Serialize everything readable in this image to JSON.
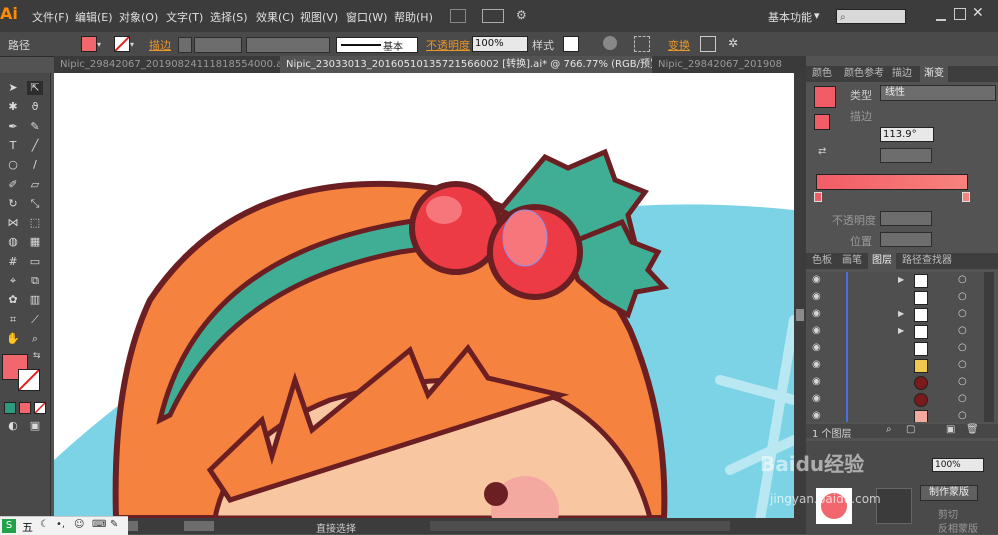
{
  "app": {
    "logo_text": "Ai"
  },
  "menubar": {
    "items": [
      "文件(F)",
      "编辑(E)",
      "对象(O)",
      "文字(T)",
      "选择(S)",
      "效果(C)",
      "视图(V)",
      "窗口(W)",
      "帮助(H)"
    ],
    "workspace_label": "基本功能",
    "workspace_arrow": "▾"
  },
  "controlbar": {
    "selection_type": "路径",
    "stroke_label": "描边",
    "stroke_profile": "基本",
    "opacity_label": "不透明度",
    "opacity_value": "100%",
    "style_label": "样式",
    "transform_label": "变换",
    "fill_color": "#f2676e"
  },
  "tabs": [
    {
      "label": "Nipic_29842067_20190824111818554000.ai*",
      "close": "×"
    },
    {
      "label": "Nipic_23033013_20160510135721566002 [转换].ai* @ 766.77% (RGB/预览)",
      "close": "×"
    },
    {
      "label": "Nipic_29842067_201908",
      "close": ""
    }
  ],
  "tools": {
    "fill_color": "#f2676e",
    "stroke_color": "none"
  },
  "gradient_panel": {
    "tabs": [
      "颜色",
      "颜色参考",
      "描边",
      "渐变"
    ],
    "type_label": "类型",
    "type_value": "线性",
    "stroke_label": "描边",
    "angle_value": "113.9°",
    "opacity_label": "不透明度",
    "position_label": "位置",
    "gradient_start": "#f25c66",
    "gradient_end": "#f7837d"
  },
  "layers_panel": {
    "tabs": [
      "色板",
      "画笔",
      "图层",
      "路径查找器"
    ],
    "footer_count": "1 个图层",
    "rows": [
      {
        "thumb": "#f2676e"
      },
      {
        "thumb": "#ffffff"
      },
      {
        "thumb": "#ffffff"
      },
      {
        "thumb": "#ffffff"
      },
      {
        "thumb": "#ffffff"
      },
      {
        "thumb": "#f0c84e"
      },
      {
        "thumb": "#7a1a1a"
      },
      {
        "thumb": "#7a1a1a"
      },
      {
        "thumb": "#f4a9a0"
      }
    ]
  },
  "transparency_panel": {
    "opacity_value": "100%",
    "make_mask_label": "制作蒙版",
    "clip_label": "剪切",
    "invert_label": "反相蒙版"
  },
  "statusbar": {
    "tool_label": "直接选择"
  },
  "ime": {
    "label": "五"
  },
  "watermark": {
    "text": "Baidu经验",
    "sub": "jingyan.baidu.com"
  }
}
